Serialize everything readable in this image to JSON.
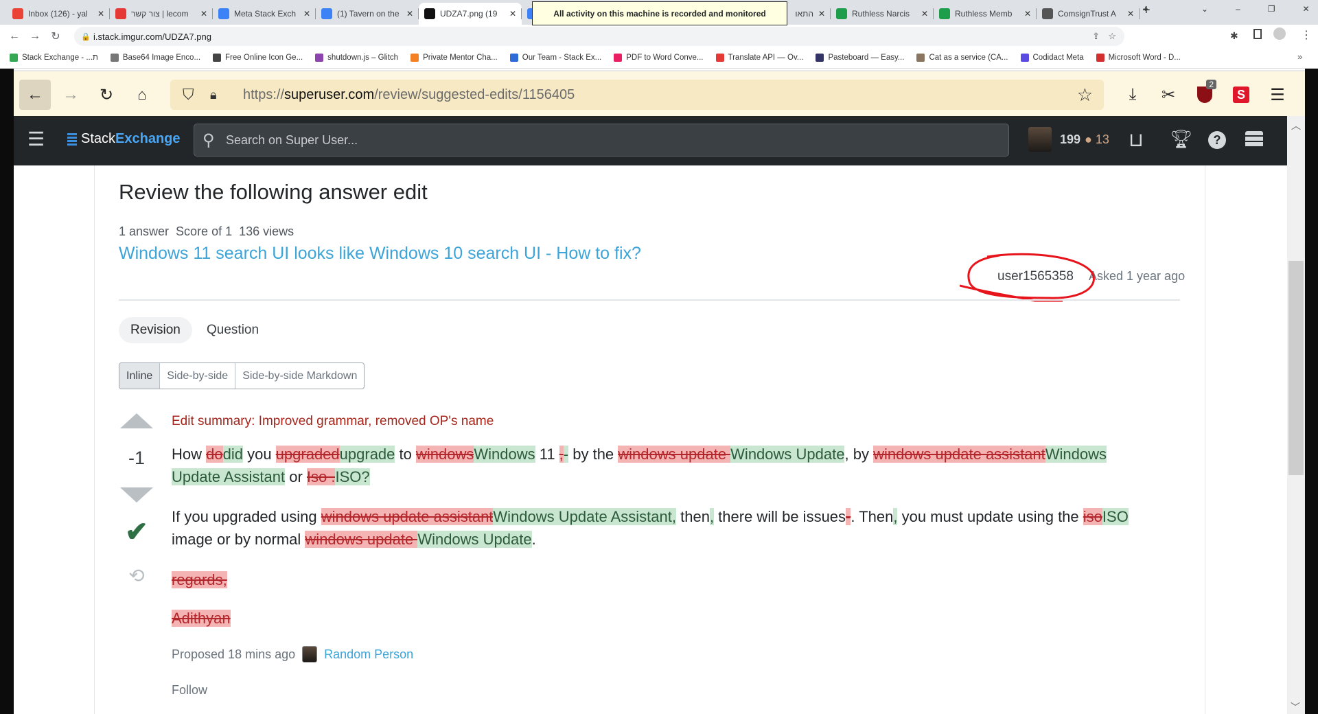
{
  "chrome": {
    "tabs": [
      {
        "label": "Inbox (126) - yal",
        "icon": "gmail-icon",
        "color": "#ea4335"
      },
      {
        "label": "צור קשר | lecom",
        "icon": "g-icon",
        "color": "#e53935"
      },
      {
        "label": "Meta Stack Exch",
        "icon": "chat-bubble-icon",
        "color": "#3b82f6"
      },
      {
        "label": "(1) Tavern on the",
        "icon": "chat-bubble-icon",
        "color": "#3b82f6"
      },
      {
        "label": "UDZA7.png (19",
        "icon": "imgur-icon",
        "color": "#111111",
        "active": true
      },
      {
        "label": "",
        "icon": "chat-bubble-icon",
        "color": "#3b82f6"
      },
      {
        "label": "",
        "icon": "",
        "color": ""
      },
      {
        "label": "התאו",
        "icon": "",
        "color": ""
      },
      {
        "label": "Ruthless Narcis",
        "icon": "cross-icon",
        "color": "#1e9e4a"
      },
      {
        "label": "Ruthless Memb",
        "icon": "cross-icon",
        "color": "#1e9e4a"
      },
      {
        "label": "ComsignTrust A",
        "icon": "globe-icon",
        "color": "#555555"
      }
    ],
    "tooltip": "All activity on this machine is recorded and monitored",
    "url": "i.stack.imgur.com/UDZA7.png",
    "bookmarks": [
      {
        "label": "Stack Exchange - ...ת",
        "color": "#34a853"
      },
      {
        "label": "Base64 Image Enco...",
        "color": "#777777"
      },
      {
        "label": "Free Online Icon Ge...",
        "color": "#444444"
      },
      {
        "label": "shutdown.js – Glitch",
        "color": "#8e44ad"
      },
      {
        "label": "Private Mentor Cha...",
        "color": "#f48024"
      },
      {
        "label": "Our Team - Stack Ex...",
        "color": "#2e6bd8"
      },
      {
        "label": "PDF to Word Conve...",
        "color": "#e91e63"
      },
      {
        "label": "Translate API — Ov...",
        "color": "#e53935"
      },
      {
        "label": "Pasteboard — Easy...",
        "color": "#333366"
      },
      {
        "label": "Cat as a service (CA...",
        "color": "#8a7560"
      },
      {
        "label": "Codidact Meta",
        "color": "#5b4be0"
      },
      {
        "label": "Microsoft Word - D...",
        "color": "#d32f2f"
      }
    ]
  },
  "firefox": {
    "url_prefix": "https://",
    "url_host": "superuser.com",
    "url_path": "/review/suggested-edits/1156405",
    "badge": "2"
  },
  "navbar": {
    "brand_1": "Stack",
    "brand_2": "Exchange",
    "search_placeholder": "Search on Super User...",
    "reputation": "199",
    "bronze": "13",
    "bronze_color": "#d1a684"
  },
  "review": {
    "title": "Review the following answer edit",
    "stats": [
      "1 answer",
      "Score of 1",
      "136 views"
    ],
    "question_link": "Windows 11 search UI looks like Windows 10 search UI - How to fix?",
    "asker": "user1565358",
    "asked": "Asked 1 year ago",
    "tabs": [
      "Revision",
      "Question"
    ],
    "view_modes": [
      "Inline",
      "Side-by-side",
      "Side-by-side Markdown"
    ],
    "score": "-1",
    "edit_summary": "Edit summary: Improved grammar, removed OP's name",
    "paragraphs": [
      [
        [
          "same",
          "How "
        ],
        [
          "del",
          "do"
        ],
        [
          "ins",
          "did"
        ],
        [
          "same",
          " you "
        ],
        [
          "del",
          "upgraded"
        ],
        [
          "ins",
          "upgrade"
        ],
        [
          "same",
          " to "
        ],
        [
          "del",
          "windows"
        ],
        [
          "ins",
          "Windows"
        ],
        [
          "same",
          " 11 "
        ],
        [
          "del",
          ","
        ],
        [
          "ins",
          "-"
        ],
        [
          "same",
          " by the "
        ],
        [
          "del",
          "windows update "
        ],
        [
          "ins",
          "Windows Update"
        ],
        [
          "same",
          ", by "
        ],
        [
          "del",
          "windows update assistant"
        ],
        [
          "ins",
          "Windows Update Assistant"
        ],
        [
          "same",
          " or "
        ],
        [
          "del",
          "Iso ."
        ],
        [
          "ins",
          "ISO?"
        ]
      ],
      [
        [
          "same",
          "If you upgraded using "
        ],
        [
          "del",
          "windows update assistant"
        ],
        [
          "ins",
          "Windows Update Assistant,"
        ],
        [
          "same",
          " then"
        ],
        [
          "ins",
          ","
        ],
        [
          "same",
          " there will be issues"
        ],
        [
          "del",
          "-"
        ],
        [
          "same",
          ". Then"
        ],
        [
          "ins",
          ","
        ],
        [
          "same",
          " you must update using the "
        ],
        [
          "del",
          "iso"
        ],
        [
          "ins",
          "ISO"
        ],
        [
          "same",
          " image or by normal "
        ],
        [
          "del",
          "windows update "
        ],
        [
          "ins",
          "Windows Update"
        ],
        [
          "same",
          "."
        ]
      ],
      [
        [
          "del",
          "regards,"
        ]
      ],
      [
        [
          "del",
          "Adithyan"
        ]
      ]
    ],
    "proposed": "Proposed 18 mins ago",
    "proposer": "Random Person",
    "follow": "Follow"
  },
  "colors": {
    "accent": "#3ca4d8",
    "deleted_bg": "#f4b4b4",
    "inserted_bg": "#c8e6d0",
    "annotation": "#e8141c"
  }
}
